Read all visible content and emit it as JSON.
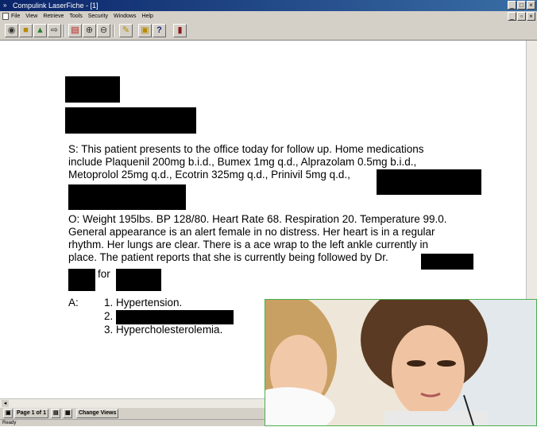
{
  "window": {
    "title": "Compulink LaserFiche - [1]"
  },
  "menubar": {
    "items": [
      "File",
      "View",
      "Retrieve",
      "Tools",
      "Security",
      "Windows",
      "Help"
    ]
  },
  "toolbar": {
    "icons": [
      "binoculars-icon",
      "open-folder-icon",
      "tree-icon",
      "export-icon",
      "page-icon",
      "zoom-in-icon",
      "zoom-out-icon",
      "annotate-icon",
      "stamp-icon",
      "help-icon",
      "book-icon"
    ]
  },
  "document": {
    "subjective": [
      "S:  This patient presents to the office today for follow up. Home medications",
      "include Plaquenil 200mg b.i.d., Bumex 1mg q.d., Alprazolam 0.5mg b.i.d.,",
      "Metoprolol 25mg q.d., Ecotrin 325mg q.d., Prinivil 5mg q.d.,"
    ],
    "objective": [
      "O:  Weight 195lbs. BP 128/80. Heart Rate 68. Respiration 20. Temperature 99.0.",
      "General appearance is an alert female in no distress. Her heart is in a regular",
      "rhythm. Her lungs are clear.  There is a ace wrap to the left ankle currently in",
      "place. The patient reports that she is currently being followed by Dr."
    ],
    "for_word": "for",
    "assessment_label": "A:",
    "assessment_items": [
      "1. Hypertension.",
      "2.",
      "3. Hypercholesterolemia."
    ]
  },
  "statusbar": {
    "page_label": "Page 1 of 1",
    "change_views": "Change Views",
    "ready": "Ready"
  },
  "colors": {
    "titlebar": "#0a246a",
    "chrome": "#d4d0c8",
    "photo_border": "#4caf50"
  }
}
